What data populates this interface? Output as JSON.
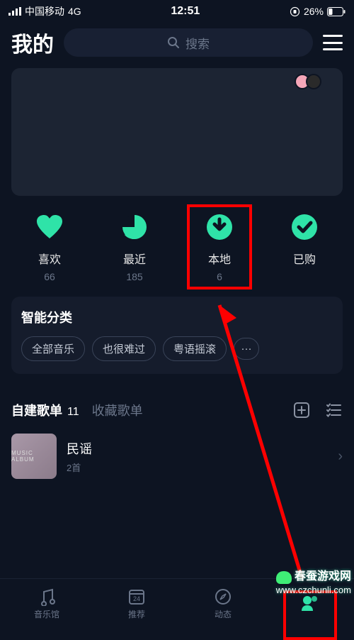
{
  "status": {
    "carrier": "中国移动",
    "network": "4G",
    "time": "12:51",
    "battery_pct": "26%"
  },
  "header": {
    "title": "我的",
    "search_placeholder": "搜索"
  },
  "shortcuts": [
    {
      "id": "like",
      "label": "喜欢",
      "count": "66"
    },
    {
      "id": "recent",
      "label": "最近",
      "count": "185"
    },
    {
      "id": "local",
      "label": "本地",
      "count": "6"
    },
    {
      "id": "bought",
      "label": "已购",
      "count": ""
    }
  ],
  "smart": {
    "title": "智能分类",
    "chips": [
      "全部音乐",
      "也很难过",
      "粤语摇滚"
    ]
  },
  "playlists": {
    "tab_self": "自建歌单",
    "tab_self_count": "11",
    "tab_fav": "收藏歌单",
    "items": [
      {
        "name": "民谣",
        "sub": "2首",
        "cover_text": "MUSIC ALBUM"
      }
    ]
  },
  "nav": [
    {
      "id": "library",
      "label": "音乐馆"
    },
    {
      "id": "recommend",
      "label": "推荐",
      "badge_text": "24"
    },
    {
      "id": "moments",
      "label": "动态"
    },
    {
      "id": "mine",
      "label": ""
    }
  ],
  "accent": "#2fe3a8",
  "watermark": {
    "line1": "春蚕游戏网",
    "line2": "www.czchunli.com"
  }
}
